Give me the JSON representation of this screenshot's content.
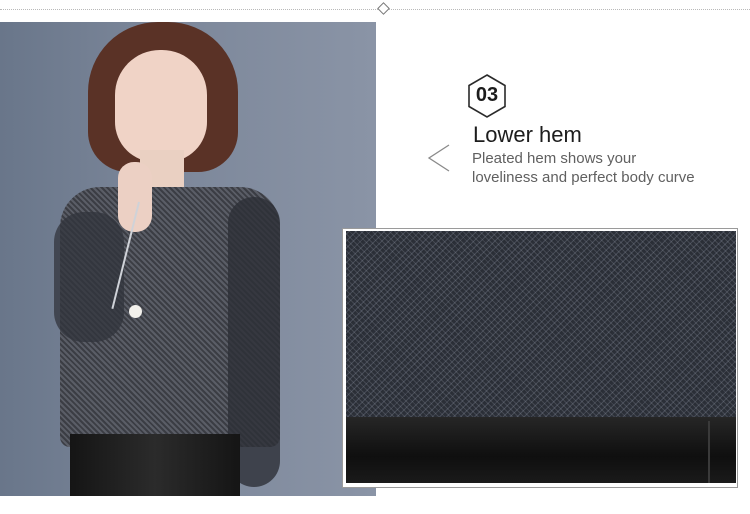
{
  "feature": {
    "number": "03",
    "title": "Lower hem",
    "description_lines": [
      "Pleated hem shows your",
      "loveliness and perfect body curve"
    ]
  },
  "icons": {
    "hexagon": "hexagon-outline-icon",
    "chevron": "chevron-left-icon"
  },
  "colors": {
    "background": "#ffffff",
    "title_text": "#1d1d1d",
    "description_text": "#606060",
    "divider": "#b9b9b9"
  }
}
